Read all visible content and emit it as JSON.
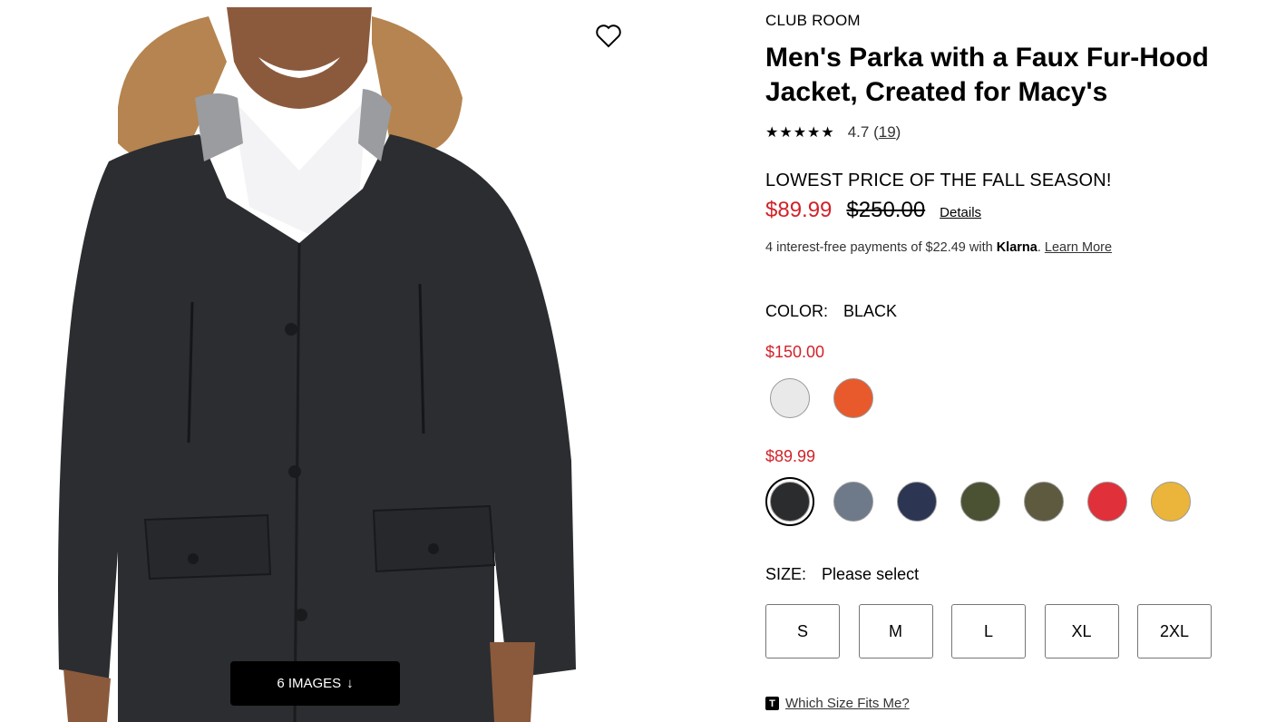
{
  "gallery": {
    "images_label": "6 IMAGES"
  },
  "product": {
    "brand": "CLUB ROOM",
    "title": "Men's Parka with a Faux Fur-Hood Jacket, Created for Macy's",
    "rating_stars": "★★★★★",
    "rating_value": "4.7",
    "review_count": "19",
    "promo": "LOWEST PRICE OF THE FALL SEASON!",
    "sale_price": "$89.99",
    "original_price": "$250.00",
    "details_label": "Details",
    "klarna_prefix": "4 interest-free payments of $22.49 with",
    "klarna_brand": "Klarna",
    "klarna_learn": "Learn More",
    "color_label": "COLOR:",
    "color_value": "BLACK",
    "price_groups": [
      {
        "price": "$150.00",
        "colors": [
          "#e8e9e8",
          "#e85a2c"
        ]
      },
      {
        "price": "$89.99",
        "colors": [
          "#2b2c2e",
          "#6e7a8a",
          "#2c3552",
          "#4a5233",
          "#5e5a40",
          "#e0303a",
          "#eab53a"
        ]
      }
    ],
    "size_label": "SIZE:",
    "size_value": "Please select",
    "sizes": [
      "S",
      "M",
      "L",
      "XL",
      "2XL"
    ],
    "fit_icon": "T",
    "fit_label": "Which Size Fits Me?"
  }
}
